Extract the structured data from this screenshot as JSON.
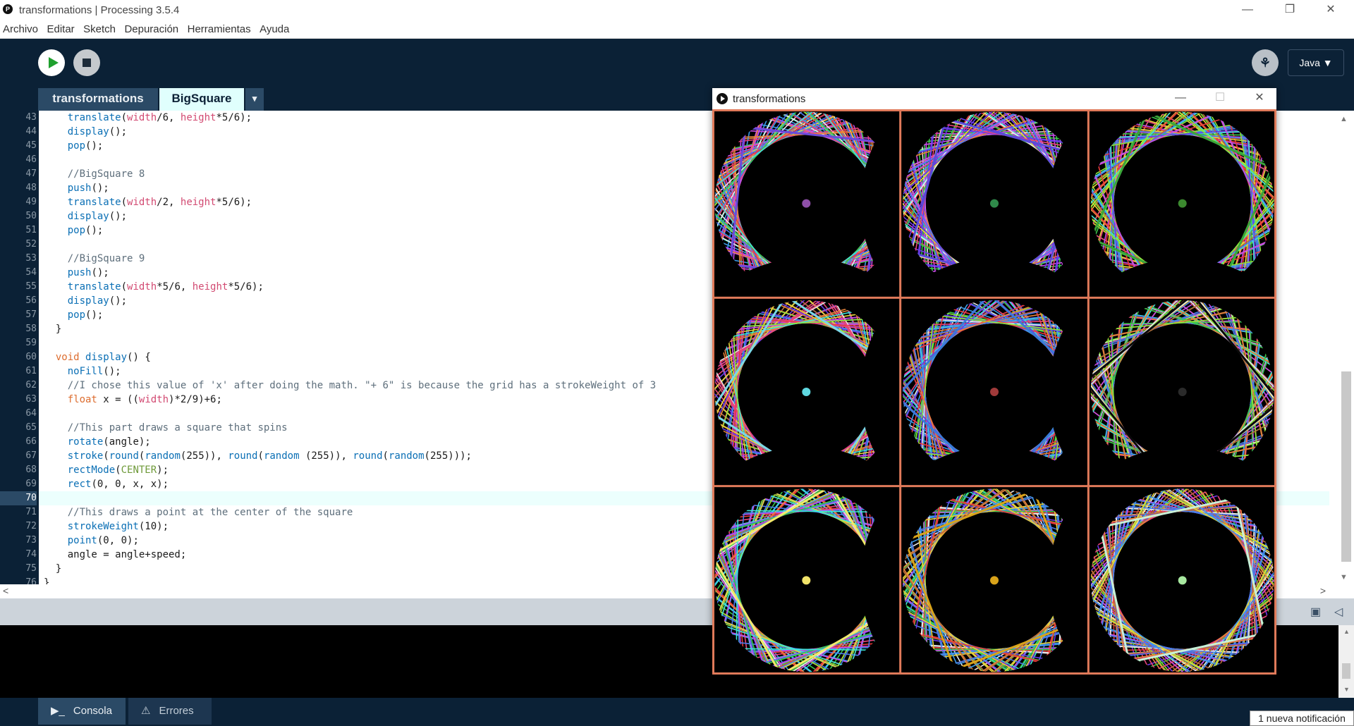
{
  "window": {
    "title": "transformations | Processing 3.5.4",
    "app_icon": "p5-icon"
  },
  "window_controls": {
    "minimize": "—",
    "restore": "❐",
    "close": "✕"
  },
  "menu": [
    "Archivo",
    "Editar",
    "Sketch",
    "Depuración",
    "Herramientas",
    "Ayuda"
  ],
  "toolbar": {
    "run_icon": "play-icon",
    "stop_icon": "stop-icon",
    "debug_icon": "butterfly-icon",
    "debug_glyph": "⚘",
    "mode_label": "Java ▼"
  },
  "tabs": [
    {
      "label": "transformations",
      "active": false
    },
    {
      "label": "BigSquare",
      "active": true
    }
  ],
  "tab_menu_glyph": "▾",
  "editor": {
    "first_line": 43,
    "current_line": 70,
    "lines": [
      "    translate(width/6, height*5/6);",
      "    display();",
      "    pop();",
      "",
      "    //BigSquare 8",
      "    push();",
      "    translate(width/2, height*5/6);",
      "    display();",
      "    pop();",
      "",
      "    //BigSquare 9",
      "    push();",
      "    translate(width*5/6, height*5/6);",
      "    display();",
      "    pop();",
      "  }",
      "",
      "  void display() {",
      "    noFill();",
      "    //I chose this value of 'x' after doing the math. \"+ 6\" is because the grid has a strokeWeight of 3",
      "    float x = ((width)*2/9)+6;",
      "",
      "    //This part draws a square that spins",
      "    rotate(angle);",
      "    stroke(round(random(255)), round(random (255)), round(random(255)));",
      "    rectMode(CENTER);",
      "    rect(0, 0, x, x);",
      "",
      "    //This draws a point at the center of the square",
      "    strokeWeight(10);",
      "    point(0, 0);",
      "    angle = angle+speed;",
      "  }",
      "}"
    ]
  },
  "scrollbar": {
    "up": "▲",
    "down": "▼",
    "left": "<",
    "right": ">"
  },
  "status_icons": {
    "copy": "▣",
    "collapse": "◁"
  },
  "bottom_tabs": [
    {
      "label": "Consola",
      "icon": "console-icon",
      "glyph": "▶_"
    },
    {
      "label": "Errores",
      "icon": "warning-icon",
      "glyph": "⚠"
    }
  ],
  "notification": "1 nueva notificación",
  "sketch_window": {
    "title": "transformations",
    "icon": "play-icon",
    "controls": {
      "minimize": "—",
      "maximize": "☐",
      "close": "✕"
    },
    "grid_color": "#e07a5a",
    "dot_colors": [
      "#8e4fa8",
      "#2f8a4a",
      "#3c8a2f",
      "#5fd8e0",
      "#a03a3a",
      "#2a2a2a",
      "#f2e46a",
      "#d9a31a",
      "#a8e8a0"
    ],
    "square_colors": [
      "#6a4ad9",
      "#5a4ad9",
      "#3aa63a",
      "#7ad7e8",
      "#3a7ad9",
      "#0a0a0a",
      "#f2ea6a",
      "#d9a31a",
      "#c8f0d8"
    ]
  }
}
